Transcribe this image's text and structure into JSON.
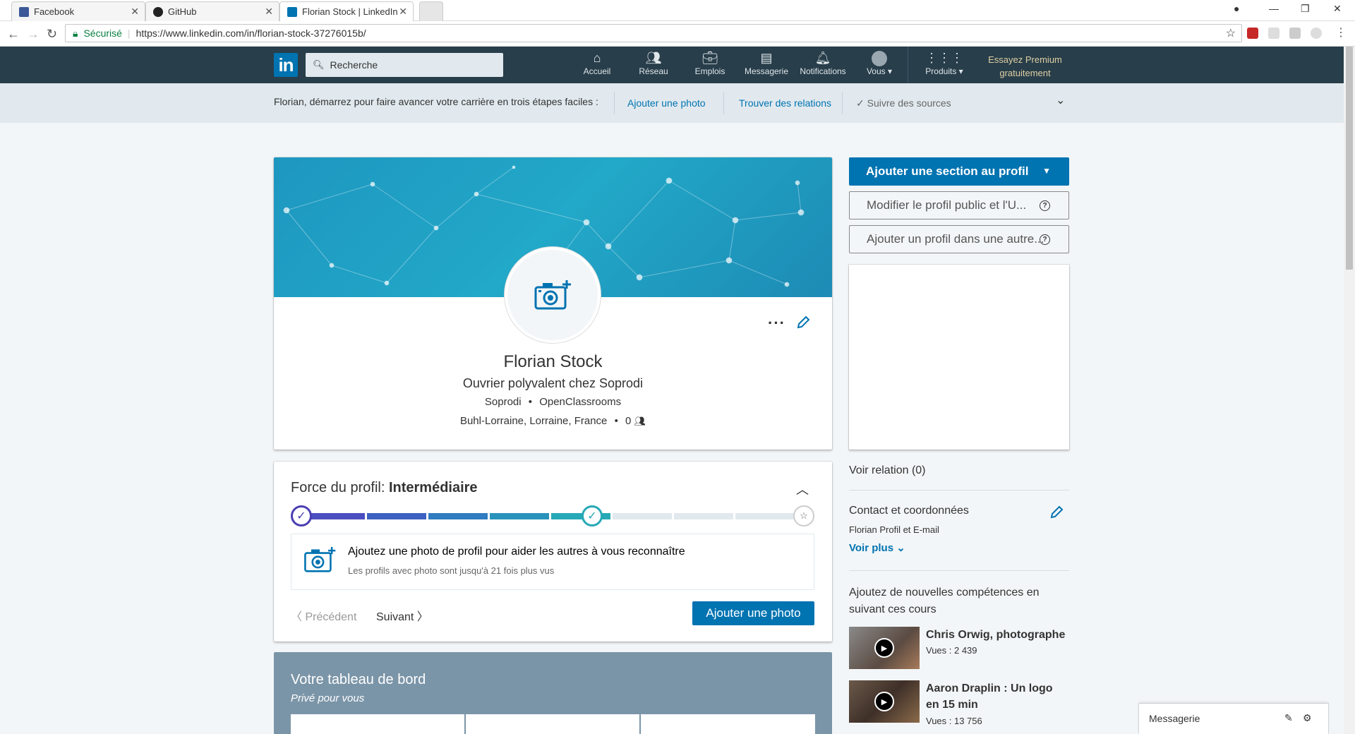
{
  "browser": {
    "tabs": [
      {
        "label": "Facebook",
        "favicon_color": "#3b5998"
      },
      {
        "label": "GitHub",
        "favicon_color": "#222222"
      },
      {
        "label": "Florian Stock | LinkedIn",
        "favicon_color": "#0073b1"
      }
    ],
    "secure_label": "Sécurisé",
    "url": "https://www.linkedin.com/in/florian-stock-37276015b/"
  },
  "navbar": {
    "logo": "in",
    "search_placeholder": "Recherche",
    "items": [
      {
        "label": "Accueil",
        "icon": "home-icon"
      },
      {
        "label": "Réseau",
        "icon": "network-icon"
      },
      {
        "label": "Emplois",
        "icon": "jobs-icon"
      },
      {
        "label": "Messagerie",
        "icon": "messaging-icon"
      },
      {
        "label": "Notifications",
        "icon": "bell-icon"
      },
      {
        "label": "Vous",
        "icon": "avatar-icon"
      },
      {
        "label": "Produits",
        "icon": "grid-icon"
      }
    ],
    "premium_line1": "Essayez Premium",
    "premium_line2": "gratuitement"
  },
  "onboarding": {
    "intro": "Florian, démarrez pour faire avancer votre carrière en trois étapes faciles :",
    "steps": [
      "Ajouter une photo",
      "Trouver des relations"
    ],
    "done_step": "Suivre des sources"
  },
  "profile": {
    "name": "Florian Stock",
    "headline": "Ouvrier polyvalent chez Soprodi",
    "company": "Soprodi",
    "school": "OpenClassrooms",
    "location": "Buhl-Lorraine, Lorraine, France",
    "connections": "0",
    "bullet": "•"
  },
  "strength": {
    "label": "Force du profil:",
    "level": "Intermédiaire",
    "progress_fraction": 0.5,
    "tip_title": "Ajoutez une photo de profil pour aider les autres à vous reconnaître",
    "tip_subtitle": "Les profils avec photo sont jusqu'à 21 fois plus vus",
    "prev_label": "Précédent",
    "next_label": "Suivant",
    "cta_label": "Ajouter une photo"
  },
  "dashboard": {
    "title": "Votre tableau de bord",
    "subtitle": "Privé pour vous"
  },
  "right_rail": {
    "add_section": "Ajouter une section au profil",
    "edit_public": "Modifier le profil public et l'U...",
    "add_other_lang": "Ajouter un profil dans une autre...",
    "relations": "Voir relation (0)",
    "contact_title": "Contact et coordonnées",
    "contact_sub": "Florian Profil et E-mail",
    "voir_plus": "Voir plus",
    "courses_heading": "Ajoutez de nouvelles compétences en suivant ces cours",
    "courses": [
      {
        "title": "Chris Orwig, photographe",
        "views": "Vues : 2 439"
      },
      {
        "title": "Aaron Draplin : Un logo en 15 min",
        "views": "Vues : 13 756"
      }
    ]
  },
  "messaging": {
    "label": "Messagerie"
  },
  "colors": {
    "brand_blue": "#0073b1",
    "nav_bg": "#283e4a",
    "premium_gold": "#dfcfa4"
  }
}
